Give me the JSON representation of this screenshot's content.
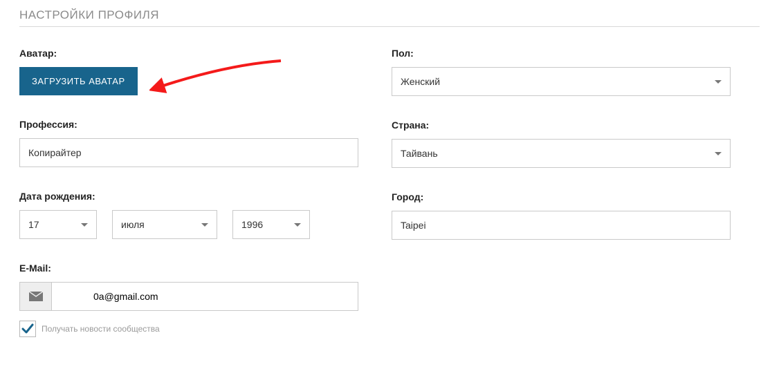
{
  "title": "НАСТРОЙКИ ПРОФИЛЯ",
  "avatar": {
    "label": "Аватар:",
    "button": "ЗАГРУЗИТЬ АВАТАР"
  },
  "profession": {
    "label": "Профессия:",
    "value": "Копирайтер"
  },
  "dob": {
    "label": "Дата рождения:",
    "day": "17",
    "month": "июля",
    "year": "1996"
  },
  "email": {
    "label": "E-Mail:",
    "value": "0a@gmail.com"
  },
  "newsletter": {
    "label": "Получать новости сообщества",
    "checked": true
  },
  "gender": {
    "label": "Пол:",
    "value": "Женский"
  },
  "country": {
    "label": "Страна:",
    "value": "Тайвань"
  },
  "city": {
    "label": "Город:",
    "value": "Taipei"
  },
  "colors": {
    "accent": "#18648c",
    "annotation": "#f41a1a"
  }
}
